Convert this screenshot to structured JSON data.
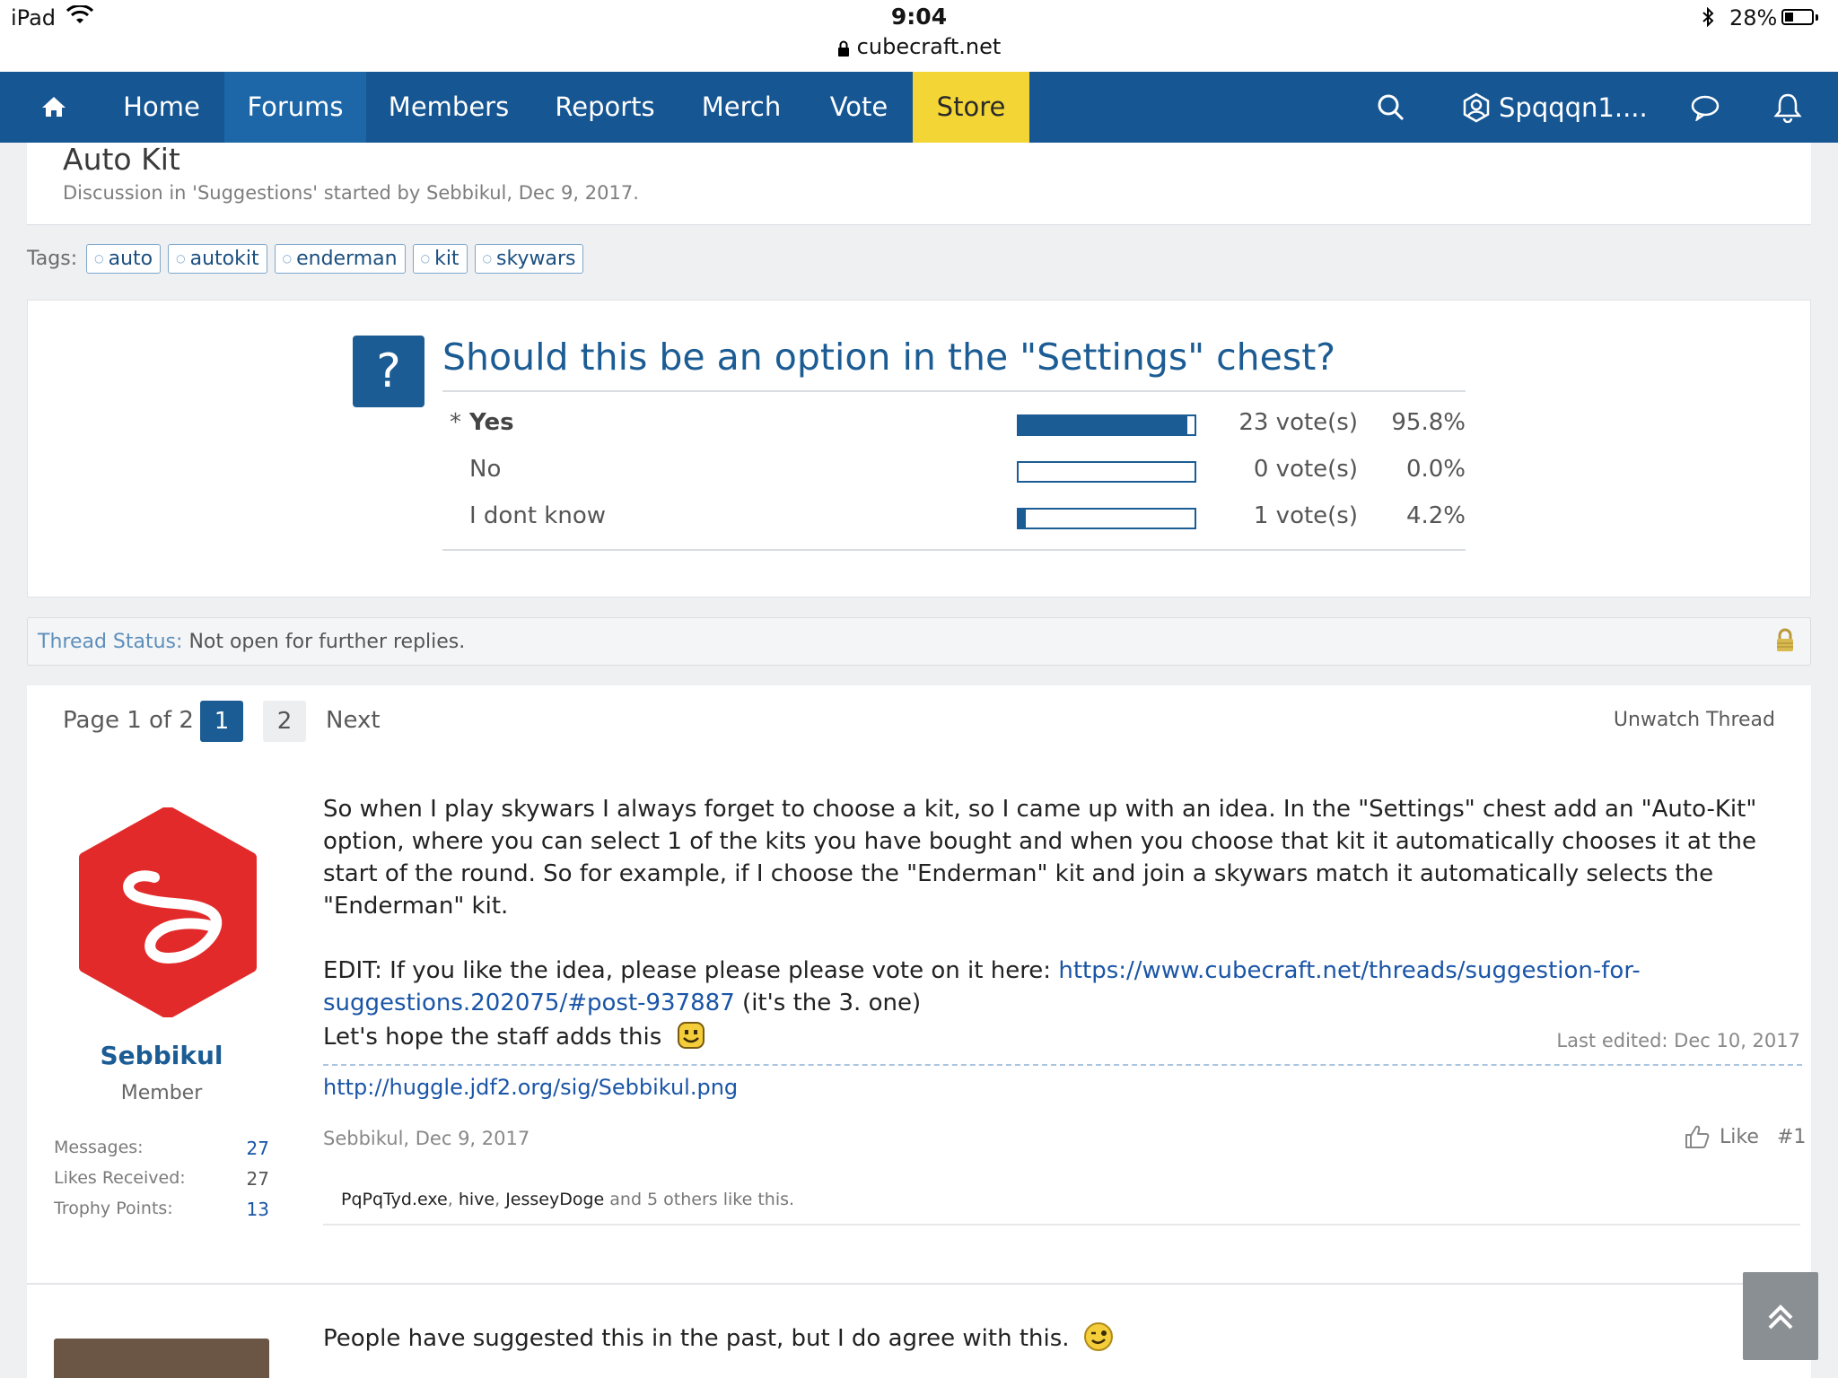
{
  "status_bar": {
    "device": "iPad",
    "time": "9:04",
    "url": "cubecraft.net",
    "battery": "28%"
  },
  "nav": {
    "home_label": "Home",
    "forums_label": "Forums",
    "members_label": "Members",
    "reports_label": "Reports",
    "merch_label": "Merch",
    "vote_label": "Vote",
    "store_label": "Store",
    "username": "Spqqqn1...."
  },
  "thread": {
    "title": "Auto Kit",
    "description": "Discussion in 'Suggestions' started by Sebbikul, Dec 9, 2017."
  },
  "tags": {
    "label": "Tags:",
    "items": [
      "auto",
      "autokit",
      "enderman",
      "kit",
      "skywars"
    ]
  },
  "poll": {
    "icon": "?",
    "question": "Should this be an option in the \"Settings\" chest?",
    "options": [
      {
        "marker": "*",
        "label": "Yes",
        "votes": "23 vote(s)",
        "percent": "95.8%",
        "fill": 0.958
      },
      {
        "marker": "",
        "label": "No",
        "votes": "0 vote(s)",
        "percent": "0.0%",
        "fill": 0.0
      },
      {
        "marker": "",
        "label": "I dont know",
        "votes": "1 vote(s)",
        "percent": "4.2%",
        "fill": 0.042
      }
    ]
  },
  "thread_status": {
    "label": "Thread Status:",
    "text": "Not open for further replies."
  },
  "pagination": {
    "page_text": "Page 1 of 2",
    "pages": [
      "1",
      "2"
    ],
    "next": "Next",
    "unwatch": "Unwatch Thread"
  },
  "post": {
    "username": "Sebbikul",
    "user_title": "Member",
    "stats": [
      {
        "label": "Messages:",
        "value": "27"
      },
      {
        "label": "Likes Received:",
        "value": "27"
      },
      {
        "label": "Trophy Points:",
        "value": "13"
      }
    ],
    "paragraph1": "So when I play skywars I always forget to choose a kit, so I came up with an idea. In the \"Settings\" chest add an \"Auto-Kit\" option, where you can select 1 of the kits you have bought and when you choose that kit it automatically chooses it at the start of the round. So for example, if I choose the \"Enderman\" kit and join a skywars match it automatically selects the \"Enderman\" kit.",
    "edit_prefix": "EDIT: If you like the idea, please please please vote on it here: ",
    "edit_link": "https://www.cubecraft.net/threads/suggestion-for-suggestions.202075/#post-937887",
    "edit_suffix": " (it's the 3. one)",
    "hope_text": "Let's hope the staff adds this",
    "last_edited": "Last edited: Dec 10, 2017",
    "signature_link": "http://huggle.jdf2.org/sig/Sebbikul.png",
    "meta": "Sebbikul, Dec 9, 2017",
    "like_label": "Like",
    "post_number": "#1",
    "likers": [
      "PqPqTyd.exe",
      "hive",
      "JesseyDoge"
    ],
    "likes_suffix": "and 5 others like this."
  },
  "second_post": {
    "text": "People have suggested this in the past, but I do agree with this."
  }
}
